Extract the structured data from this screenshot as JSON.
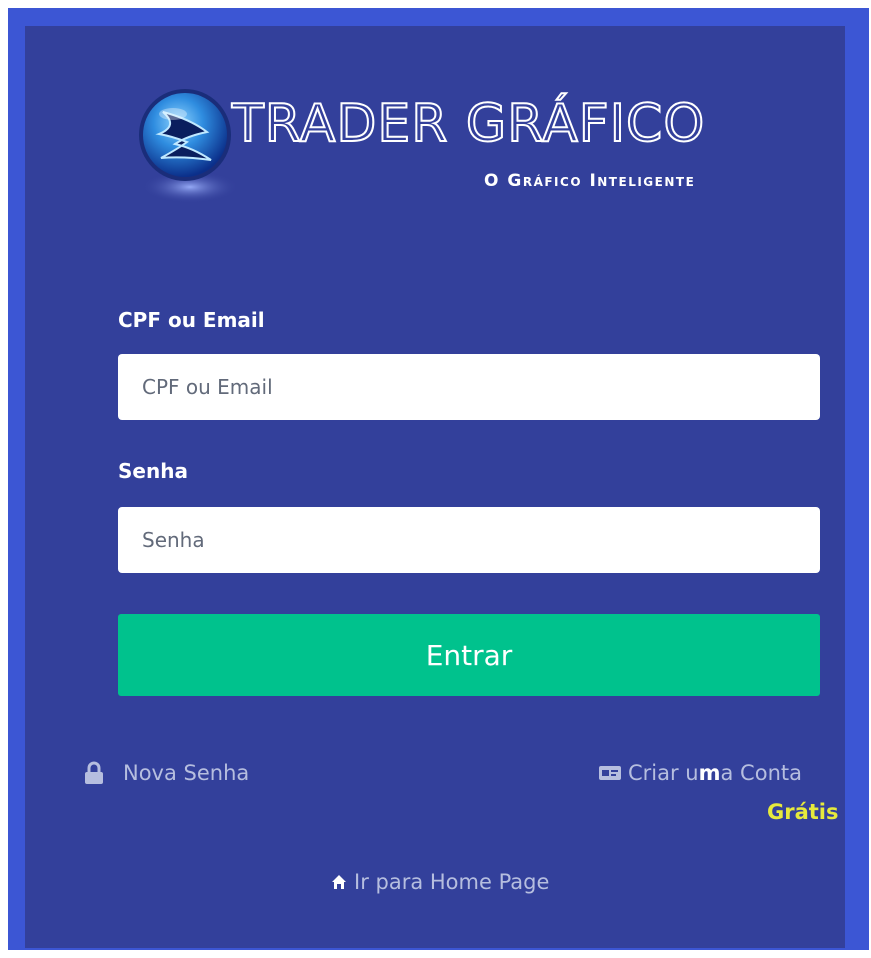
{
  "logo": {
    "title": "TRADER GRÁFICO",
    "tagline": "O Gráfico Inteligente"
  },
  "form": {
    "cpf_label": "CPF ou Email",
    "cpf_placeholder": "CPF ou Email",
    "cpf_value": "",
    "senha_label": "Senha",
    "senha_placeholder": "Senha",
    "senha_value": "",
    "submit_label": "Entrar"
  },
  "links": {
    "nova_senha": "Nova Senha",
    "criar_conta_before": "Criar u",
    "criar_conta_bold": "m",
    "criar_conta_after": "a Conta",
    "gratis": "Grátis",
    "home": "Ir para Home Page"
  },
  "icons": {
    "lock": "lock-icon",
    "card": "id-card-icon",
    "home": "home-icon"
  },
  "colors": {
    "outer_border": "#3c56d4",
    "panel_background": "#33409b",
    "button": "#00c28d",
    "gratis": "#e6ea3c",
    "link_text": "#b6bedf"
  }
}
